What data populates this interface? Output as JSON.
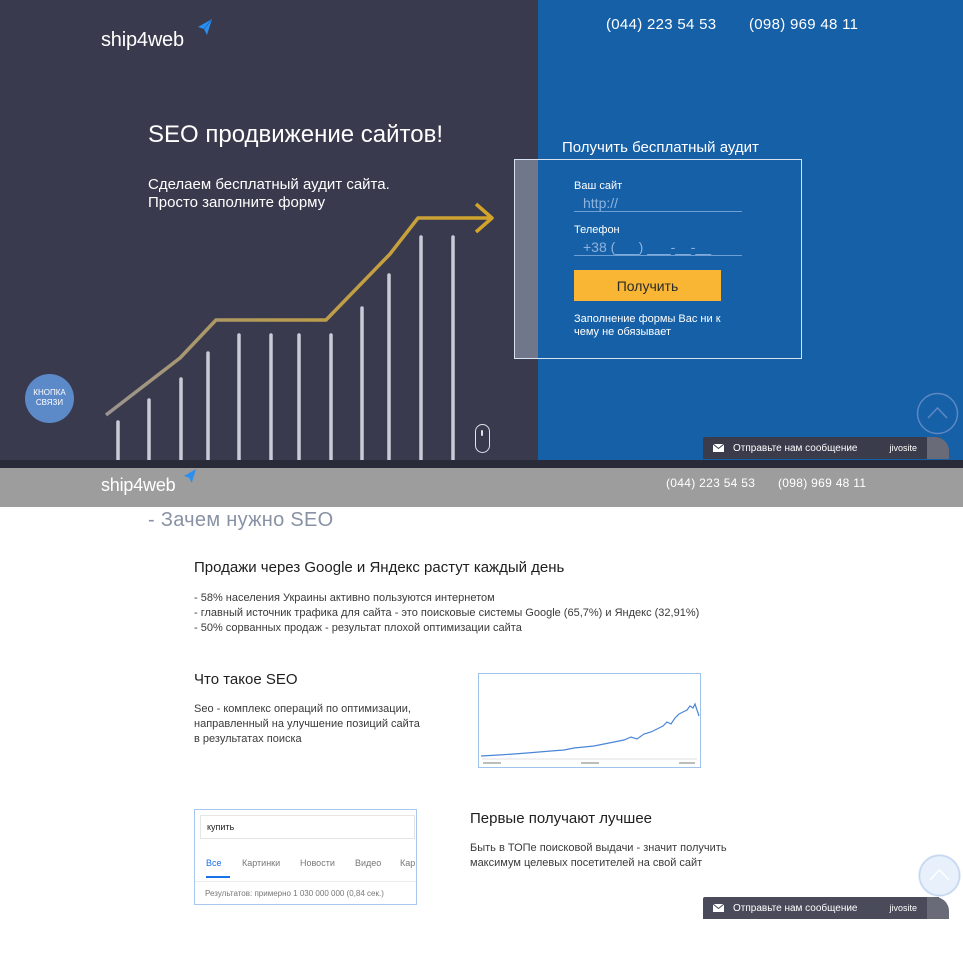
{
  "brand": {
    "name": "ship4web",
    "accent_color": "#2a8ff0"
  },
  "header": {
    "phone_1": "(044) 223 54 53",
    "phone_2": "(098) 969 48 11"
  },
  "hero": {
    "title": "SEO продвижение сайтов!",
    "subtitle_line1": "Сделаем бесплатный аудит сайта.",
    "subtitle_line2": "Просто заполните форму",
    "colors": {
      "left": "#393a4d",
      "right": "#1660a8",
      "arrow": "#c9a227"
    },
    "callback_label": "КНОПКА СВЯЗИ"
  },
  "form": {
    "title": "Получить бесплатный аудит",
    "site_label": "Ваш сайт",
    "site_placeholder": "http://",
    "phone_label": "Телефон",
    "phone_placeholder": "+38 (___) ___-__-__",
    "submit_label": "Получить",
    "submit_color": "#f8b634",
    "note": "Заполнение формы Вас ни к чему не обязывает"
  },
  "chat_widget": {
    "label": "Отправьте нам сообщение",
    "brand": "jivosite",
    "icon": "envelope-icon"
  },
  "sticky_header": {
    "phone_1": "(044) 223 54 53",
    "phone_2": "(098) 969 48 11"
  },
  "why_seo": {
    "title": "- Зачем нужно SEO",
    "sales_heading": "Продажи через Google и Яндекс растут каждый день",
    "sales_points": [
      "- 58% населения Украины активно пользуются интернетом",
      "- главный источник трафика для сайта - это поисковые системы Google (65,7%) и Яндекс (32,91%)",
      "- 50% сорванных продаж - результат плохой оптимизации сайта"
    ],
    "what_heading": "Что такое SEO",
    "what_text_1": "Seo - комплекс операций по оптимизации,",
    "what_text_2": "направленный на улучшение позиций сайта",
    "what_text_3": "в результатах поиска",
    "first_heading": "Первые получают лучшее",
    "first_text_1": "Быть в ТОПе поисковой выдачи - значит получить",
    "first_text_2": "максимум целевых посетителей на свой сайт"
  },
  "search_example": {
    "query": "купить",
    "tabs": [
      "Все",
      "Картинки",
      "Новости",
      "Видео",
      "Кар"
    ],
    "results": "Результатов: примерно 1 030 000 000 (0,84 сек.)"
  }
}
